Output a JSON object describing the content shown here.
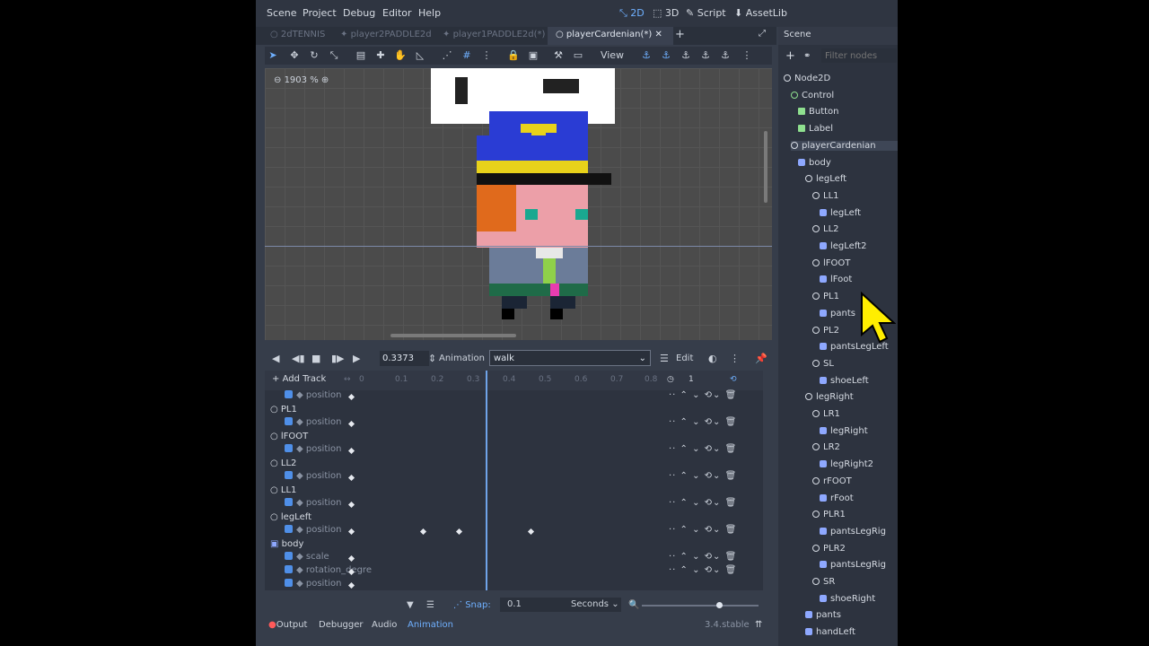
{
  "menu": [
    "Scene",
    "Project",
    "Debug",
    "Editor",
    "Help"
  ],
  "modes": {
    "m2d": "2D",
    "m3d": "3D",
    "script": "Script",
    "assetlib": "AssetLib"
  },
  "tabs": [
    "2dTENNIS",
    "player2PADDLE2d",
    "player1PADDLE2d(*)",
    "playerCardenian(*)"
  ],
  "toolbar": {
    "view": "View"
  },
  "viewport": {
    "zoom": "1903 %"
  },
  "animation": {
    "time": "0.3373",
    "label": "Animation",
    "selected": "walk",
    "edit": "Edit"
  },
  "timeline": {
    "add_track": "Add Track",
    "ticks": [
      "0",
      "0.1",
      "0.2",
      "0.3",
      "0.4",
      "0.5",
      "0.6",
      "0.7",
      "0.8"
    ],
    "loop_count": "1",
    "tracks": [
      {
        "node": "",
        "prop": "position"
      },
      {
        "node": "PL1",
        "prop": "position"
      },
      {
        "node": "lFOOT",
        "prop": "position"
      },
      {
        "node": "LL2",
        "prop": "position"
      },
      {
        "node": "LL1",
        "prop": "position"
      },
      {
        "node": "legLeft",
        "prop": "position"
      },
      {
        "node": "body",
        "props": [
          "scale",
          "rotation_degre",
          "position"
        ]
      }
    ]
  },
  "bottom": {
    "snap_label": "Snap:",
    "snap_value": "0.1",
    "seconds": "Seconds"
  },
  "status": {
    "output": "Output",
    "debugger": "Debugger",
    "audio": "Audio",
    "animation": "Animation",
    "version": "3.4.stable"
  },
  "scene": {
    "title": "Scene",
    "filter_placeholder": "Filter nodes",
    "nodes": [
      {
        "label": "Node2D",
        "type": "node"
      },
      {
        "label": "Control",
        "type": "ctl"
      },
      {
        "label": "Button",
        "type": "btn"
      },
      {
        "label": "Label",
        "type": "lbl"
      },
      {
        "label": "playerCardenian",
        "type": "node"
      },
      {
        "label": "body",
        "type": "spr"
      },
      {
        "label": "legLeft",
        "type": "node"
      },
      {
        "label": "LL1",
        "type": "node"
      },
      {
        "label": "legLeft",
        "type": "spr"
      },
      {
        "label": "LL2",
        "type": "node"
      },
      {
        "label": "legLeft2",
        "type": "spr"
      },
      {
        "label": "lFOOT",
        "type": "node"
      },
      {
        "label": "lFoot",
        "type": "spr"
      },
      {
        "label": "PL1",
        "type": "node"
      },
      {
        "label": "pants",
        "type": "spr"
      },
      {
        "label": "PL2",
        "type": "node"
      },
      {
        "label": "pantsLegLeft",
        "type": "spr"
      },
      {
        "label": "SL",
        "type": "node"
      },
      {
        "label": "shoeLeft",
        "type": "spr"
      },
      {
        "label": "legRight",
        "type": "node"
      },
      {
        "label": "LR1",
        "type": "node"
      },
      {
        "label": "legRight",
        "type": "spr"
      },
      {
        "label": "LR2",
        "type": "node"
      },
      {
        "label": "legRight2",
        "type": "spr"
      },
      {
        "label": "rFOOT",
        "type": "node"
      },
      {
        "label": "rFoot",
        "type": "spr"
      },
      {
        "label": "PLR1",
        "type": "node"
      },
      {
        "label": "pantsLegRig",
        "type": "spr"
      },
      {
        "label": "PLR2",
        "type": "node"
      },
      {
        "label": "pantsLegRig",
        "type": "spr"
      },
      {
        "label": "SR",
        "type": "node"
      },
      {
        "label": "shoeRight",
        "type": "spr"
      },
      {
        "label": "pants",
        "type": "spr"
      },
      {
        "label": "handLeft",
        "type": "spr"
      }
    ]
  },
  "colors": {
    "accent": "#6fb0ff",
    "panel": "#363d4a",
    "hat": "#2a3cd4",
    "skin": "#ec9fa8"
  }
}
